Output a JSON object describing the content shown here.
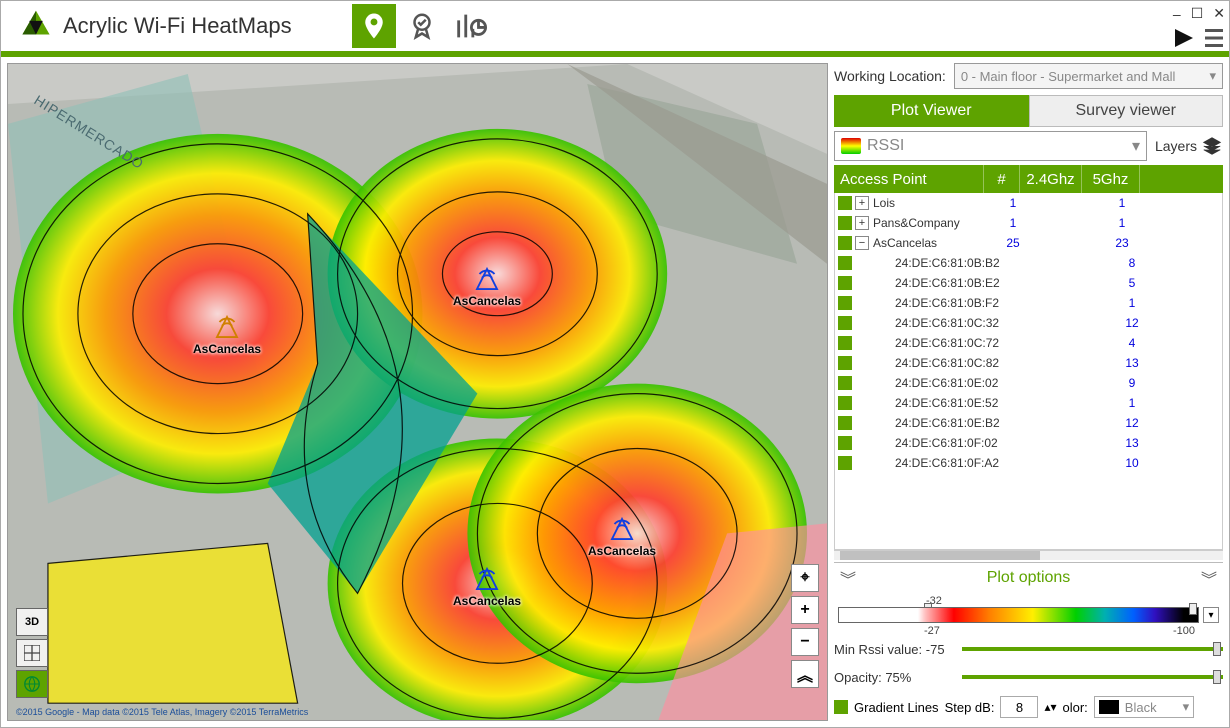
{
  "app": {
    "title": "Acrylic Wi-Fi HeatMaps"
  },
  "working_location": {
    "label": "Working Location:",
    "value": "0 - Main floor - Supermarket and Mall"
  },
  "tabs": {
    "plot": "Plot Viewer",
    "survey": "Survey viewer"
  },
  "plot_type": "RSSI",
  "layers_label": "Layers",
  "table_headers": {
    "ap": "Access Point",
    "count": "#",
    "g24": "2.4Ghz",
    "g5": "5Ghz"
  },
  "aps": [
    {
      "name": "Lois",
      "count": 1,
      "g5": 1,
      "expandable": true,
      "expanded": false
    },
    {
      "name": "Pans&Company",
      "count": 1,
      "g5": 1,
      "expandable": true,
      "expanded": false
    },
    {
      "name": "AsCancelas",
      "count": 25,
      "g5": 23,
      "expandable": true,
      "expanded": true
    }
  ],
  "children": [
    {
      "mac": "24:DE:C6:81:0B:B2",
      "g5": 8
    },
    {
      "mac": "24:DE:C6:81:0B:E2",
      "g5": 5
    },
    {
      "mac": "24:DE:C6:81:0B:F2",
      "g5": 1
    },
    {
      "mac": "24:DE:C6:81:0C:32",
      "g5": 12
    },
    {
      "mac": "24:DE:C6:81:0C:72",
      "g5": 4
    },
    {
      "mac": "24:DE:C6:81:0C:82",
      "g5": 13
    },
    {
      "mac": "24:DE:C6:81:0E:02",
      "g5": 9
    },
    {
      "mac": "24:DE:C6:81:0E:52",
      "g5": 1
    },
    {
      "mac": "24:DE:C6:81:0E:B2",
      "g5": 12
    },
    {
      "mac": "24:DE:C6:81:0F:02",
      "g5": 13
    },
    {
      "mac": "24:DE:C6:81:0F:A2",
      "g5": 10
    }
  ],
  "plot_options": {
    "title": "Plot options",
    "tick_top": "-32",
    "scale_left": "-27",
    "scale_right": "-100",
    "min_rssi_label": "Min Rssi value:",
    "min_rssi_value": "-75",
    "opacity_label": "Opacity:",
    "opacity_value": "75%",
    "gradlines_label": "Gradient Lines",
    "step_label": "Step dB:",
    "step_value": "8",
    "color_label": "olor:",
    "color_name": "Black"
  },
  "map": {
    "hiper": "HIPERMERCADO",
    "credits": "©2015 Google - Map data ©2015 Tele Atlas, Imagery ©2015 TerraMetrics",
    "ap_name": "AsCancelas",
    "btn_3d": "3D"
  }
}
